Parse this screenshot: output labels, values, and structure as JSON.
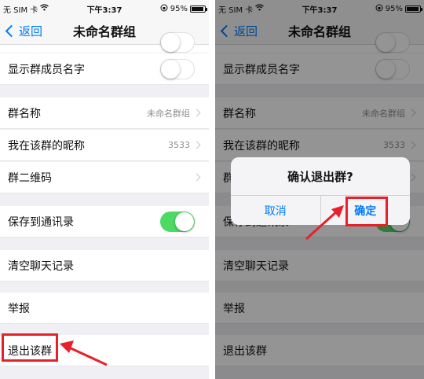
{
  "status": {
    "carrier": "无 SIM 卡",
    "time": "下午3:37",
    "battery": "95%",
    "battery_level": 0.95
  },
  "nav": {
    "back_label": "返回",
    "title": "未命名群组"
  },
  "rows": {
    "show_member_names": "显示群成员名字",
    "group_name": "群名称",
    "group_name_value": "未命名群组",
    "my_nickname": "我在该群的昵称",
    "nickname_value": "3533",
    "qr_code": "群二维码",
    "save_contacts": "保存到通讯录",
    "clear_history": "清空聊天记录",
    "report": "举报",
    "exit_group": "退出该群"
  },
  "dialog": {
    "title": "确认退出群?",
    "cancel": "取消",
    "confirm": "确定"
  },
  "colors": {
    "ios_blue": "#007aff",
    "switch_green": "#4cd964",
    "annotation_red": "#e8202a"
  }
}
